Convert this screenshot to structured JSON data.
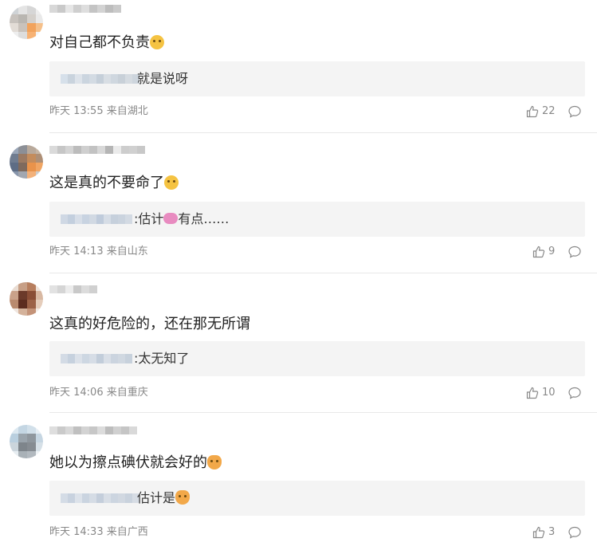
{
  "comments": [
    {
      "text": "对自己都不负责",
      "reply": {
        "text": "就是说呀"
      },
      "time": "昨天 13:55 来自湖北",
      "likes": "22",
      "emoji": "smirk-emoji"
    },
    {
      "text": "这是真的不要命了",
      "reply": {
        "text": ":估计",
        "suffix": "有点……"
      },
      "time": "昨天 14:13 来自山东",
      "likes": "9",
      "emoji": "laugh-cry-emoji"
    },
    {
      "text": "这真的好危险的，还在那无所谓",
      "reply": {
        "text": ":太无知了"
      },
      "time": "昨天 14:06 来自重庆",
      "likes": "10"
    },
    {
      "text": "她以为擦点碘伏就会好的",
      "reply": {
        "text": "估计是"
      },
      "time": "昨天 14:33 来自广西",
      "likes": "3",
      "emoji": "cat-emoji"
    }
  ],
  "icons": {
    "like": "thumbs-up-icon",
    "comment": "comment-bubble-icon"
  }
}
